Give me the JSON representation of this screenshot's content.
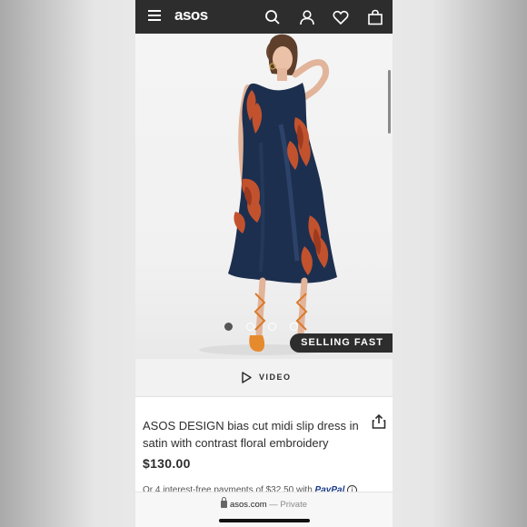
{
  "header": {
    "logo": "asos",
    "menu_icon": "hamburger-menu-icon",
    "search_icon": "search-icon",
    "account_icon": "account-icon",
    "wishlist_icon": "heart-icon",
    "bag_icon": "shopping-bag-icon",
    "background": "#2d2d2d"
  },
  "gallery": {
    "image_count": 4,
    "active_index": 0,
    "badge": "SELLING FAST"
  },
  "video": {
    "label": "VIDEO",
    "icon": "play-icon"
  },
  "product": {
    "title": "ASOS DESIGN bias cut midi slip dress in satin with contrast floral embroidery",
    "price": "$130.00",
    "installments_text": "Or 4 interest-free payments of $32.50 with",
    "paypal_label": "PayPal",
    "info_symbol": "i",
    "share_icon": "share-icon"
  },
  "browser": {
    "url": "asos.com",
    "separator": "—",
    "mode": "Private",
    "lock_icon": "lock-icon"
  }
}
